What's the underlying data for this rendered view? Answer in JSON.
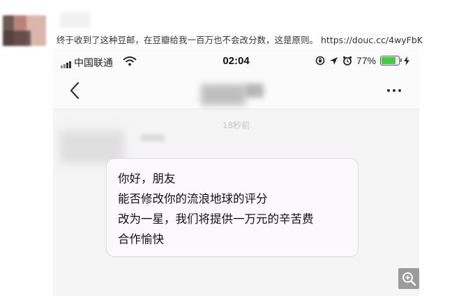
{
  "post": {
    "caption": "终于收到了这种豆邮，在豆瓣给我一百万也不会改分数，这是原则。",
    "link": "https://douc.cc/4wyFbK"
  },
  "status_bar": {
    "carrier": "中国联通",
    "time": "02:04",
    "battery_percent_text": "77%",
    "battery_level": 0.77,
    "icons": [
      "signal-icon",
      "wifi-icon",
      "screen-lock-icon",
      "location-icon",
      "alarm-icon",
      "battery-icon",
      "charging-icon"
    ]
  },
  "conversation": {
    "timestamp": "18秒前",
    "message_lines": [
      "你好，朋友",
      "能否修改你的流浪地球的评分",
      "改为一星，我们将提供一万元的辛苦费",
      "合作愉快"
    ]
  },
  "colors": {
    "battery_fill": "#3fce3f",
    "chat_background": "#f5f5f5",
    "bubble_border": "#dcdcdc"
  }
}
